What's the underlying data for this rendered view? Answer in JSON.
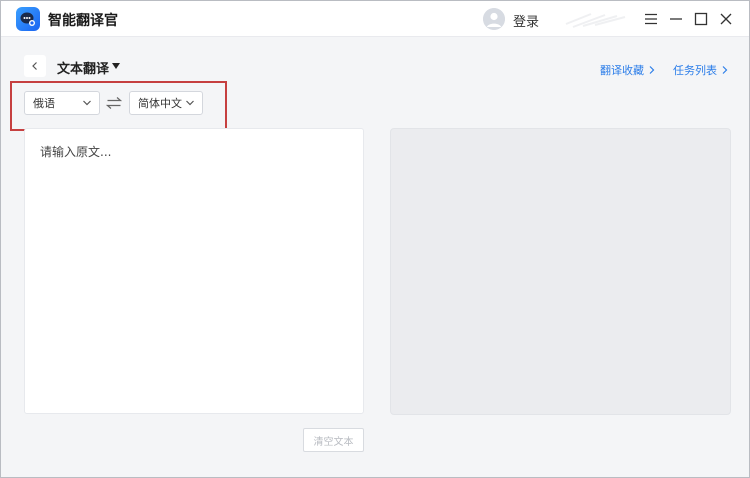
{
  "app": {
    "title": "智能翻译官",
    "login_label": "登录"
  },
  "toolbar": {
    "mode_title": "文本翻译",
    "links": {
      "favorites": "翻译收藏",
      "tasks": "任务列表"
    }
  },
  "languages": {
    "source": "俄语",
    "target": "简体中文"
  },
  "editor": {
    "source_placeholder": "请输入原文...",
    "source_value": "",
    "clear_label": "清空文本"
  },
  "colors": {
    "accent": "#2b7de9",
    "highlight": "#c64040",
    "logo": "#1a63f0"
  },
  "icons": {
    "logo": "chat-bubble-logo-icon",
    "avatar": "user-avatar-icon",
    "menu": "hamburger-menu-icon",
    "minimize": "minimize-icon",
    "maximize": "maximize-icon",
    "close": "close-icon",
    "back": "chevron-left-icon",
    "mode_dropdown": "caret-down-icon",
    "link_arrow": "chevron-right-icon",
    "select_arrow": "chevron-down-icon",
    "swap": "swap-arrows-icon"
  }
}
